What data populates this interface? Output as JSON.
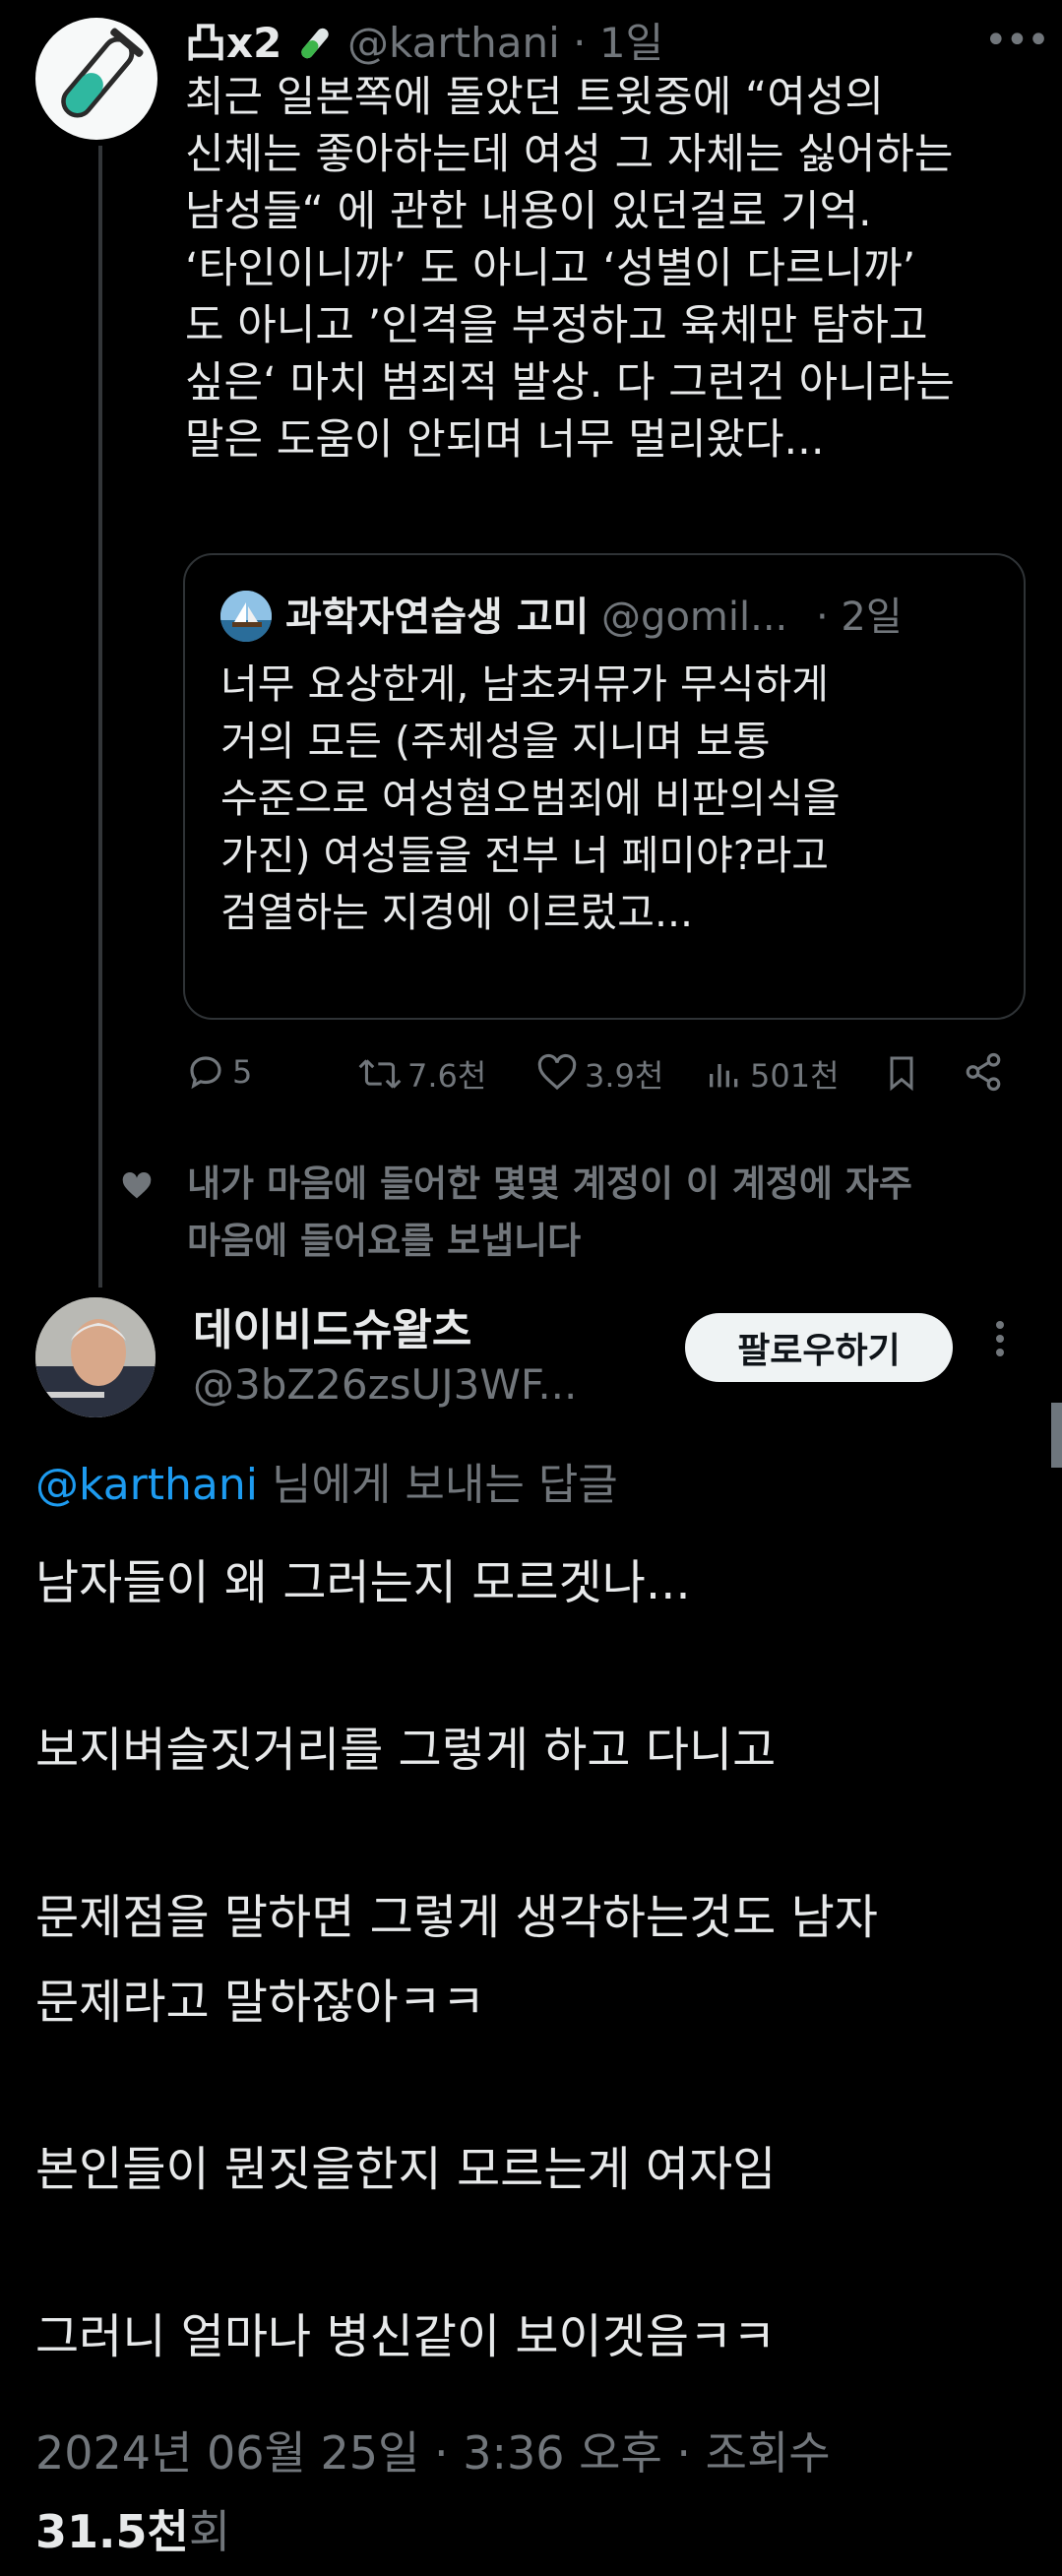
{
  "original_tweet": {
    "display_name": "凸x2",
    "handle": "@karthani",
    "time": "1일",
    "body_lines": [
      "최근 일본쪽에 돌았던 트윗중에 “여성의",
      "신체는 좋아하는데 여성 그 자체는 싫어하는",
      "남성들“ 에 관한 내용이 있던걸로 기억.",
      "‘타인이니까’ 도 아니고 ‘성별이 다르니까’",
      "도 아니고 ’인격을 부정하고 육체만 탐하고",
      "싶은‘ 마치 범죄적 발상. 다 그런건 아니라는",
      "말은 도움이 안되며 너무 멀리왔다..."
    ],
    "quote": {
      "display_name": "과학자연습생 고미",
      "handle": "@gomil...",
      "time": "· 2일",
      "body_lines": [
        "너무 요상한게, 남초커뮤가 무식하게",
        "거의 모든 (주체성을 지니며 보통",
        "수준으로 여성혐오범죄에 비판의식을",
        "가진) 여성들을 전부 너 페미야?라고",
        "검열하는 지경에 이르렀고..."
      ]
    },
    "actions": {
      "replies": "5",
      "retweets": "7.6천",
      "likes": "3.9천",
      "views": "501천"
    }
  },
  "social_context": {
    "lines": [
      "내가 마음에 들어한 몇몇 계정이 이 계정에 자주",
      "마음에 들어요를 보냅니다"
    ]
  },
  "reply_tweet": {
    "display_name": "데이비드슈왈츠",
    "handle": "@3bZ26zsUJ3WF...",
    "follow_label": "팔로우하기",
    "replying_mention": "@karthani",
    "replying_suffix": " 님에게 보내는 답글",
    "body_lines": [
      "남자들이 왜 그러는지 모르겟나...",
      "보지벼슬짓거리를 그렇게 하고 다니고",
      "문제점을 말하면 그렇게 생각하는것도 남자",
      "문제라고 말하잖아ㅋㅋ",
      "본인들이 뭔짓을한지 모르는게 여자임",
      "그러니 얼마나 병신같이 보이겟음ㅋㅋ"
    ],
    "timestamp": "2024년 06월 25일 · 3:36 오후 · 조회수",
    "view_count": "31.5천",
    "view_suffix": "회"
  },
  "colors": {
    "background": "#000000",
    "text": "#e7e9ea",
    "muted": "#71767b",
    "link": "#1d9bf0",
    "divider": "#2f3336"
  },
  "icons": {
    "test_tube": "test-tube-icon",
    "reply": "reply-icon",
    "retweet": "retweet-icon",
    "like": "heart-icon",
    "views": "views-chart-icon",
    "bookmark": "bookmark-icon",
    "share": "share-icon",
    "more": "more-icon"
  }
}
